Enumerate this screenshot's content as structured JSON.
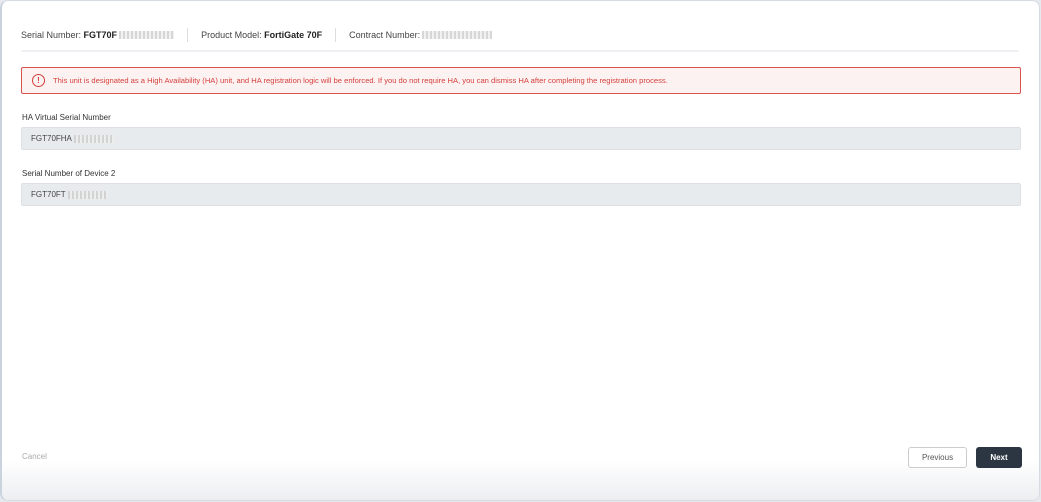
{
  "header": {
    "serial_label": "Serial Number:",
    "serial_value": "FGT70F",
    "model_label": "Product Model:",
    "model_value": "FortiGate 70F",
    "contract_label": "Contract Number:"
  },
  "alert": {
    "icon": "exclamation-circle-icon",
    "text": "This unit is designated as a High Availability (HA) unit, and HA registration logic will be enforced. If you do not require HA, you can dismiss HA after completing the registration process."
  },
  "fields": [
    {
      "label": "HA Virtual Serial Number",
      "value": "FGT70FHA"
    },
    {
      "label": "Serial Number of Device 2",
      "value": "FGT70FT"
    }
  ],
  "footer": {
    "cancel": "Cancel",
    "previous": "Previous",
    "next": "Next"
  },
  "colors": {
    "alert": "#d43f3a",
    "primary": "#2c3642"
  }
}
